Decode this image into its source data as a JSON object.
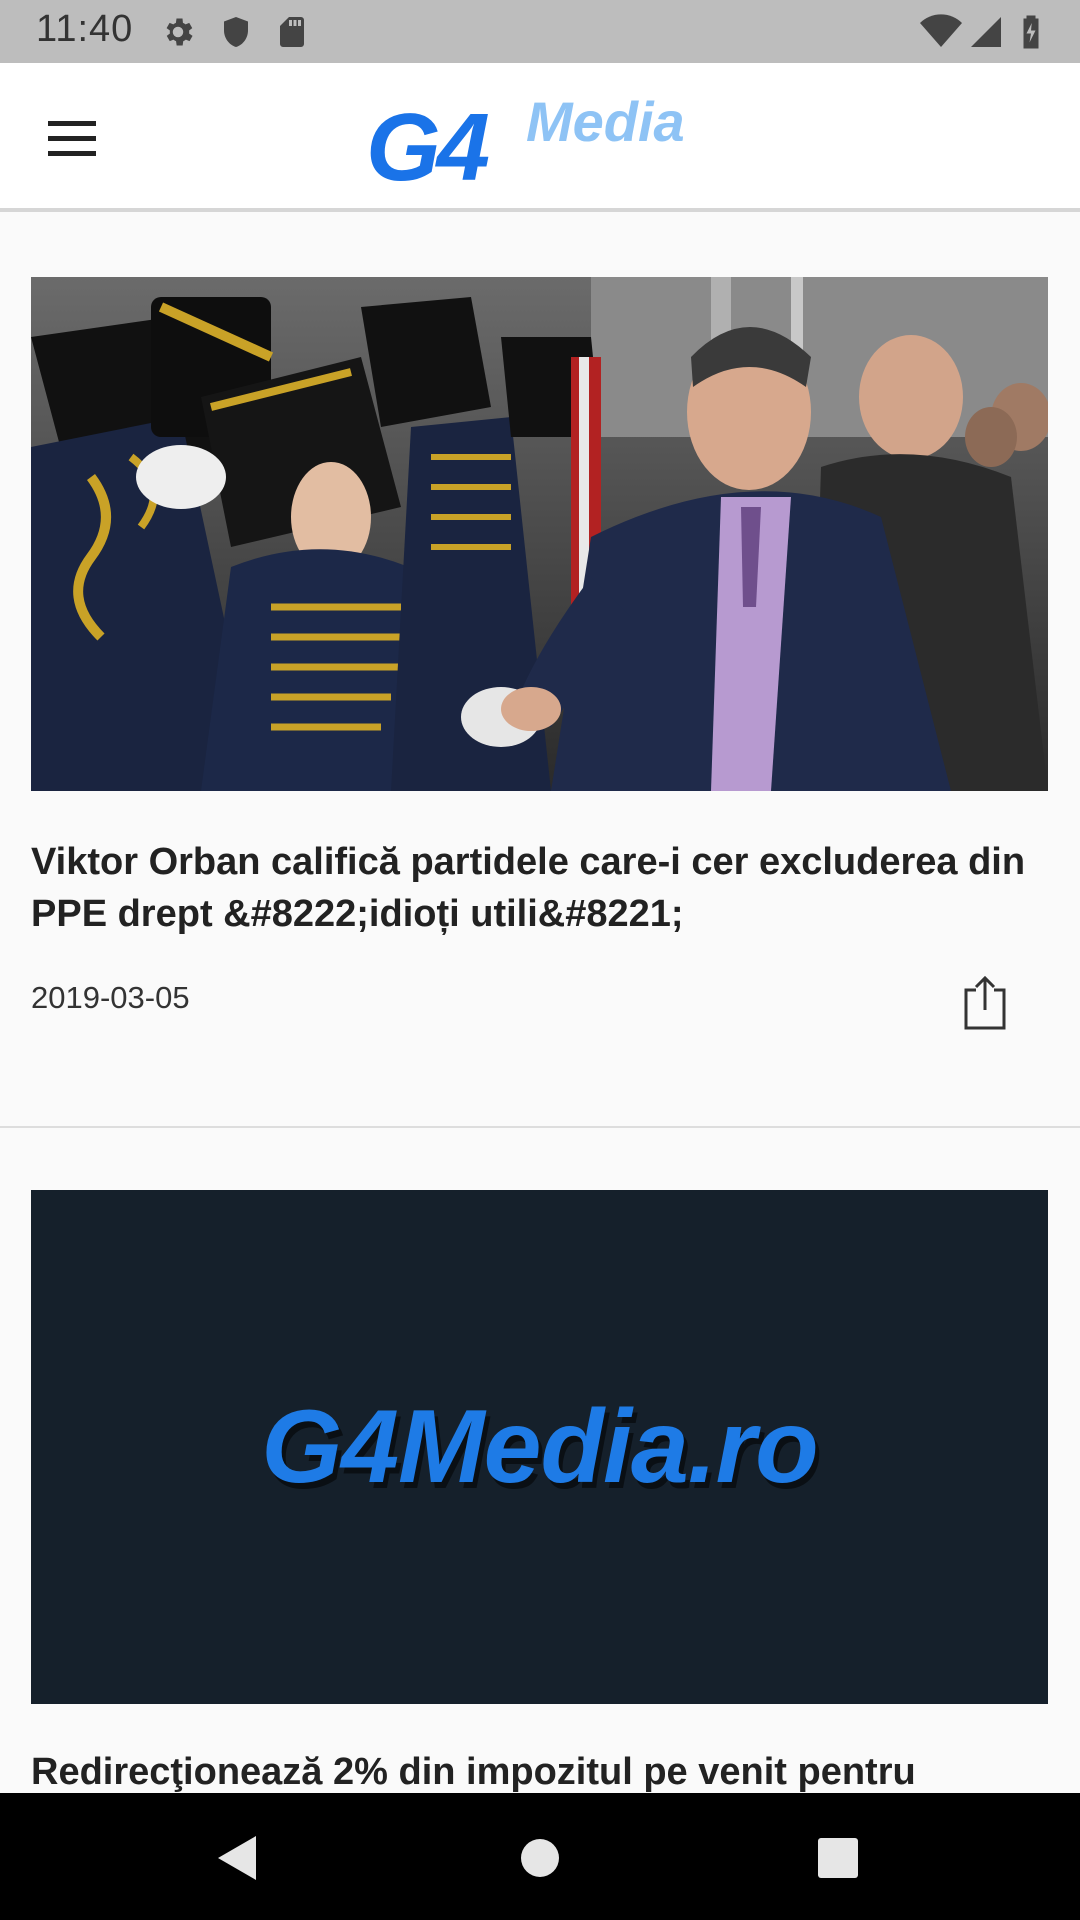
{
  "status_bar": {
    "time": "11:40",
    "left_icons": [
      "gear-icon",
      "shield-icon",
      "sd-card-icon"
    ],
    "right_icons": [
      "wifi-icon",
      "signal-icon",
      "battery-icon"
    ]
  },
  "app_bar": {
    "menu_icon": "hamburger-menu-icon",
    "logo_main": "G4",
    "logo_sub": "Media",
    "colors": {
      "logo_primary": "#1a73e8",
      "logo_secondary": "#8ec3f5"
    }
  },
  "articles": [
    {
      "image": "photo: politician shaking hands with young hussars in uniform",
      "title": "Viktor Orban califică partidele care-i cer excluderea din PPE drept &#8222;idioți utili&#8221;",
      "date": "2019-03-05",
      "share_icon": "share-icon"
    },
    {
      "image_text": "G4Media.ro",
      "title": "Redirecţionează 2% din impozitul pe venit pentru",
      "colors": {
        "banner_bg": "#15202b",
        "banner_text": "#1e7be6"
      }
    }
  ],
  "nav_bar": {
    "icons": [
      "back-icon",
      "home-icon",
      "recents-icon"
    ]
  }
}
